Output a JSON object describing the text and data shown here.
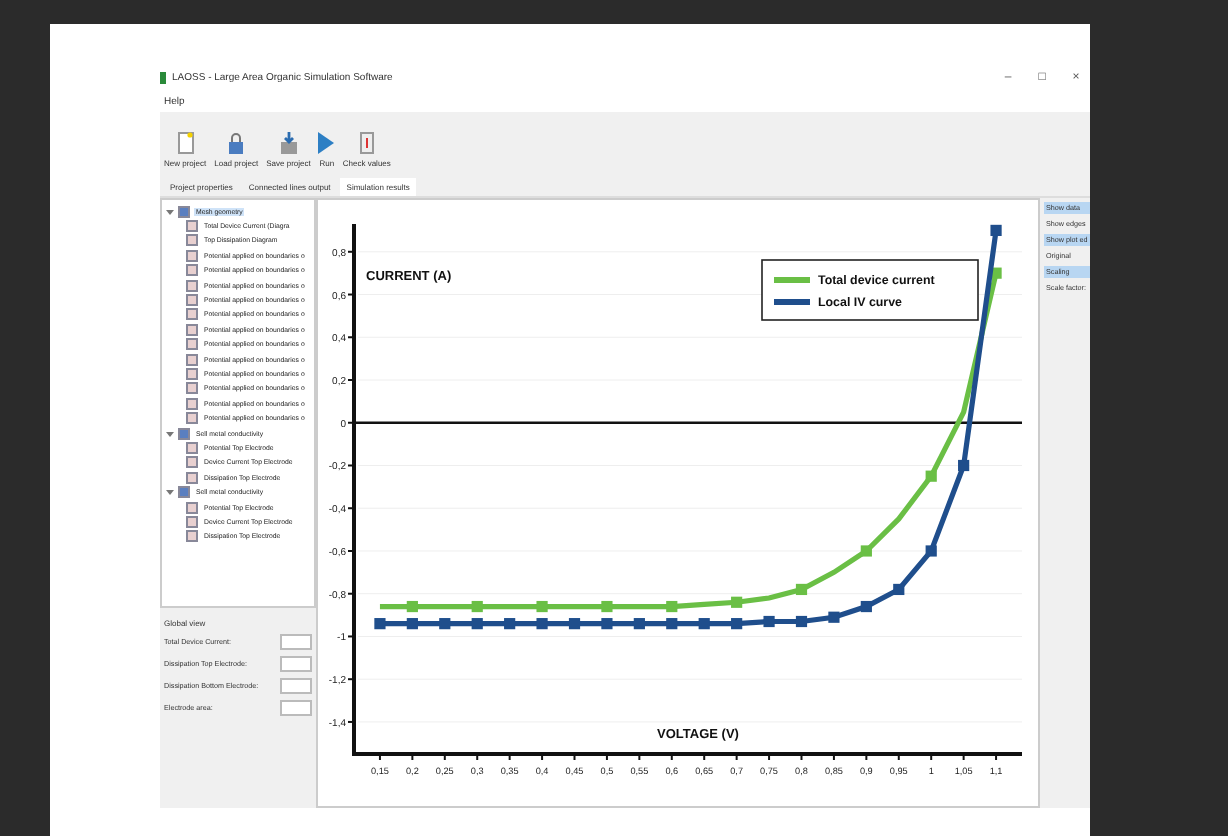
{
  "window": {
    "title": "LAOSS - Large Area Organic Simulation Software",
    "controls": [
      "–",
      "□",
      "×"
    ]
  },
  "menu": [
    "Help"
  ],
  "toolbar": [
    {
      "label": "New project"
    },
    {
      "label": "Load project"
    },
    {
      "label": "Save project"
    },
    {
      "label": "Run"
    },
    {
      "label": "Check values"
    }
  ],
  "tabs": [
    {
      "label": "Project properties",
      "selected": false
    },
    {
      "label": "Connected lines output",
      "selected": false
    },
    {
      "label": "Simulation results",
      "selected": true
    }
  ],
  "tree": [
    {
      "label": "Mesh geometry",
      "selected": true,
      "expanded": true,
      "children": [
        {
          "label": "Total Device Current (Diagra",
          "selected": false
        },
        {
          "label": "Top Dissipation Diagram",
          "selected": false
        },
        {
          "label": "Potential applied on boundaries o",
          "selected": false
        },
        {
          "label": "Potential applied on boundaries o",
          "selected": false
        },
        {
          "label": "Potential applied on boundaries o",
          "selected": false
        },
        {
          "label": "Potential applied on boundaries o",
          "selected": false
        },
        {
          "label": "Potential applied on boundaries o",
          "selected": false
        },
        {
          "label": "Potential applied on boundaries o",
          "selected": false
        },
        {
          "label": "Potential applied on boundaries o",
          "selected": false
        },
        {
          "label": "Potential applied on boundaries o",
          "selected": false
        },
        {
          "label": "Potential applied on boundaries o",
          "selected": false
        },
        {
          "label": "Potential applied on boundaries o",
          "selected": false
        },
        {
          "label": "Potential applied on boundaries o",
          "selected": false
        },
        {
          "label": "Potential applied on boundaries o",
          "selected": false
        }
      ]
    },
    {
      "label": "Sell metal conductivity",
      "selected": false,
      "expanded": true,
      "children": [
        {
          "label": "Potential Top Electrode",
          "selected": false
        },
        {
          "label": "Device Current Top Electrode",
          "selected": false
        },
        {
          "label": "Dissipation Top Electrode",
          "selected": false
        }
      ]
    },
    {
      "label": "Sell metal conductivity",
      "selected": false,
      "expanded": true,
      "children": [
        {
          "label": "Potential Top Electrode",
          "selected": false
        },
        {
          "label": "Device Current Top Electrode",
          "selected": false
        },
        {
          "label": "Dissipation Top Electrode",
          "selected": false
        }
      ]
    }
  ],
  "global_view": {
    "title": "Global view",
    "fields": [
      "Total Device Current:",
      "Dissipation Top Electrode:",
      "Dissipation Bottom Electrode:",
      "Electrode area:"
    ]
  },
  "chart": {
    "chart_data": {
      "type": "line",
      "xlabel": "VOLTAGE (V)",
      "ylabel": "CURRENT (A)",
      "xlim": [
        0.11,
        1.14
      ],
      "ylim": [
        -1.55,
        0.93
      ],
      "grid": true,
      "legend": "top right",
      "x": [
        0.15,
        0.2,
        0.25,
        0.3,
        0.35,
        0.4,
        0.45,
        0.5,
        0.55,
        0.6,
        0.65,
        0.7,
        0.75,
        0.8,
        0.85,
        0.9,
        0.95,
        1,
        1.05,
        1.1
      ],
      "series": [
        {
          "name": "Total device current",
          "color": "#6abf45",
          "marker": "square",
          "values": [
            -0.86,
            -0.86,
            -0.86,
            -0.86,
            -0.86,
            -0.86,
            -0.86,
            -0.86,
            -0.86,
            -0.86,
            -0.85,
            -0.84,
            -0.82,
            -0.78,
            -0.7,
            -0.6,
            -0.45,
            -0.25,
            0.05,
            0.7
          ]
        },
        {
          "name": "Local IV curve",
          "color": "#1f4e8c",
          "marker": "square",
          "values": [
            -0.94,
            -0.94,
            -0.94,
            -0.94,
            -0.94,
            -0.94,
            -0.94,
            -0.94,
            -0.94,
            -0.94,
            -0.94,
            -0.94,
            -0.93,
            -0.93,
            -0.91,
            -0.86,
            -0.78,
            -0.6,
            -0.2,
            0.9
          ]
        }
      ],
      "xticks": [
        {
          "value": 0.15,
          "label": "0,15"
        },
        {
          "value": 0.2,
          "label": "0,2"
        },
        {
          "value": 0.25,
          "label": "0,25"
        },
        {
          "value": 0.3,
          "label": "0,3"
        },
        {
          "value": 0.35,
          "label": "0,35"
        },
        {
          "value": 0.4,
          "label": "0,4"
        },
        {
          "value": 0.45,
          "label": "0,45"
        },
        {
          "value": 0.5,
          "label": "0,5"
        },
        {
          "value": 0.55,
          "label": "0,55"
        },
        {
          "value": 0.6,
          "label": "0,6"
        },
        {
          "value": 0.65,
          "label": "0,65"
        },
        {
          "value": 0.7,
          "label": "0,7"
        },
        {
          "value": 0.75,
          "label": "0,75"
        },
        {
          "value": 0.8,
          "label": "0,8"
        },
        {
          "value": 0.85,
          "label": "0,85"
        },
        {
          "value": 0.9,
          "label": "0,9"
        },
        {
          "value": 0.95,
          "label": "0,95"
        },
        {
          "value": 1,
          "label": "1"
        },
        {
          "value": 1.05,
          "label": "1,05"
        },
        {
          "value": 1.1,
          "label": "1,1"
        }
      ],
      "yticks": [
        {
          "value": 0.8,
          "label": "0,8"
        },
        {
          "value": 0.6,
          "label": "0,6"
        },
        {
          "value": 0.4,
          "label": "0,4"
        },
        {
          "value": 0.2,
          "label": "0,2"
        },
        {
          "value": 0,
          "label": "0"
        },
        {
          "value": -0.2,
          "label": "-0,2"
        },
        {
          "value": -0.4,
          "label": "-0,4"
        },
        {
          "value": -0.6,
          "label": "-0,6"
        },
        {
          "value": -0.8,
          "label": "-0,8"
        },
        {
          "value": -1,
          "label": "-1"
        },
        {
          "value": -1.2,
          "label": "-1,2"
        },
        {
          "value": -1.4,
          "label": "-1,4"
        }
      ]
    }
  },
  "right_panel": [
    {
      "label": "Show data",
      "selected": true
    },
    {
      "label": "Show edges",
      "selected": false
    },
    {
      "label": "Show plot ed",
      "selected": true
    },
    {
      "label": "Original",
      "selected": false
    },
    {
      "label": "Scaling",
      "selected": true
    },
    {
      "label": "Scale factor:",
      "selected": false
    }
  ]
}
